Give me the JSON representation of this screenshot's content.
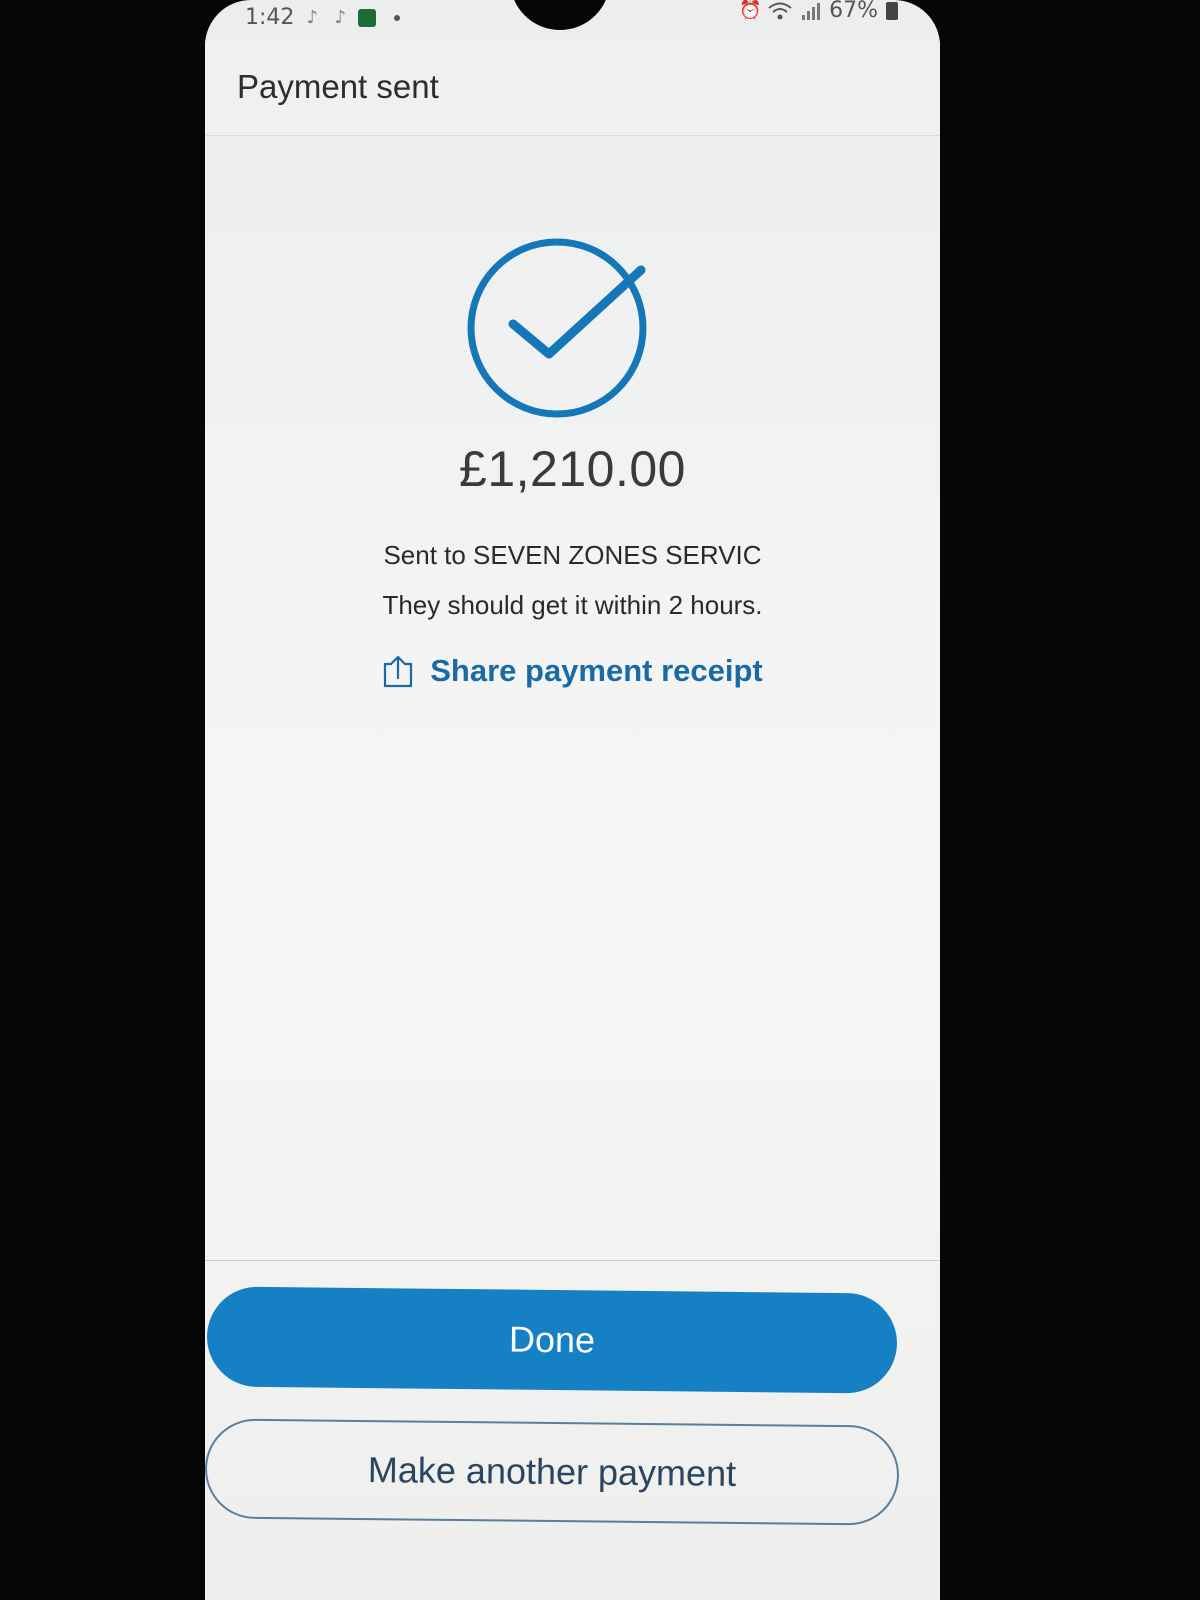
{
  "status_bar": {
    "time": "1:42",
    "battery": "67%",
    "left_icons": [
      "tiktok-icon",
      "tiktok-icon",
      "app-icon"
    ],
    "right_icons": [
      "alarm-icon",
      "wifi-icon",
      "signal-icon",
      "battery-icon"
    ]
  },
  "header": {
    "title": "Payment sent"
  },
  "confirmation": {
    "icon": "checkmark-circle-icon",
    "amount": "£1,210.00",
    "recipient_line": "Sent to SEVEN ZONES SERVIC",
    "eta_line": "They should get it within 2 hours.",
    "share_label": "Share payment receipt",
    "accent_color": "#1a6aa6"
  },
  "actions": {
    "done_label": "Done",
    "another_label": "Make another payment",
    "primary_color": "#1580c4"
  }
}
